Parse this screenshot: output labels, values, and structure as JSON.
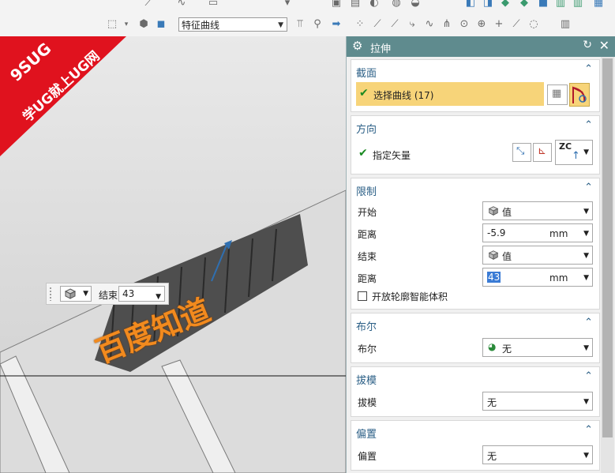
{
  "toolbar": {
    "curve_rule_value": "特征曲线"
  },
  "watermark": {
    "line1": "9SUG",
    "line2": "学UG就上UG网"
  },
  "viewport": {
    "overlay_text": "百度知道"
  },
  "float_toolbar": {
    "label": "结束",
    "value": "43"
  },
  "panel": {
    "title": "拉伸",
    "sections": {
      "section": {
        "header": "截面",
        "select_curve_label": "选择曲线 (17)"
      },
      "direction": {
        "header": "方向",
        "specify_vector_label": "指定矢量",
        "vector_value": "ZC"
      },
      "limits": {
        "header": "限制",
        "start_label": "开始",
        "start_value": "值",
        "distance1_label": "距离",
        "distance1_value": "-5.9",
        "distance1_unit": "mm",
        "end_label": "结束",
        "end_value": "值",
        "distance2_label": "距离",
        "distance2_value": "43",
        "distance2_unit": "mm",
        "open_profile_label": "开放轮廓智能体积"
      },
      "boolean": {
        "header": "布尔",
        "label": "布尔",
        "value": "无"
      },
      "draft": {
        "header": "拔模",
        "label": "拔模",
        "value": "无"
      },
      "offset": {
        "header": "偏置",
        "label": "偏置",
        "value": "无"
      }
    }
  },
  "colors": {
    "title_bar": "#5f8b8e",
    "section_header": "#2b5f86",
    "highlight": "#f7d479",
    "watermark_red": "#e0121e",
    "overlay_orange": "#f28a1e"
  }
}
